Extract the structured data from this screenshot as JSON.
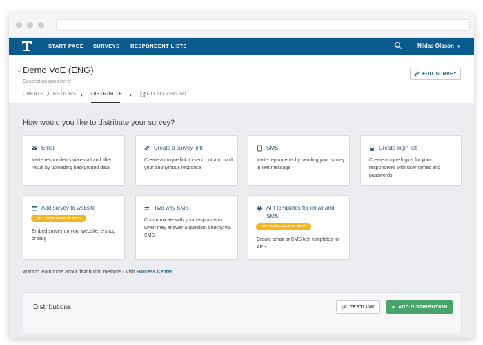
{
  "nav": {
    "items": [
      "START PAGE",
      "SURVEYS",
      "RESPONDENT LISTS"
    ],
    "user": "Niklas Olsson",
    "brand_color": "#0a5b8d"
  },
  "survey": {
    "hash": "#",
    "title": "Demo VoE (ENG)",
    "description": "Description goes here!",
    "edit_label": "EDIT SURVEY"
  },
  "tabs": [
    "CREATE QUESTIONS",
    "DISTRIBUTE",
    "GO TO REPORT"
  ],
  "distribute": {
    "question": "How would you like to distribute your survey?",
    "cards": [
      {
        "title": "Email",
        "icon": "email-icon",
        "desc": "Invite respondents via email and filter result by uploading background data"
      },
      {
        "title": "Create a survey link",
        "icon": "link-icon",
        "desc": "Create a unique link to send out and track your anonymous response"
      },
      {
        "title": "SMS",
        "icon": "phone-icon",
        "desc": "Invite repondents by sending your survey in text message"
      },
      {
        "title": "Create login list",
        "icon": "lock-icon",
        "desc": "Create unique logins for your respondents with usernames and passwords"
      },
      {
        "title": "Add survey to website",
        "icon": "website-icon",
        "badge": "NOT AVAILABLE IN BETA",
        "desc": "Embed survey on your website, e-shop or blog"
      },
      {
        "title": "Two way SMS",
        "icon": "exchange-icon",
        "desc": "Communicate with your respondents when they answer a question directly via SMS"
      },
      {
        "title": "API templates for email and SMS",
        "icon": "plug-icon",
        "badge": "NOT AVAILABLE IN BETA",
        "desc": "Create email or SMS text templates for APIs"
      }
    ],
    "learn_text": "Want to learn more about distribution methods? Visit ",
    "learn_link": "Success Center"
  },
  "distributions": {
    "title": "Distributions",
    "testlink_label": "TESTLINK",
    "add_label": "ADD DISTRIBUTION"
  },
  "colors": {
    "accent_green": "#48a36a",
    "badge_yellow": "#f5b71d",
    "link_blue": "#2c5f86"
  }
}
